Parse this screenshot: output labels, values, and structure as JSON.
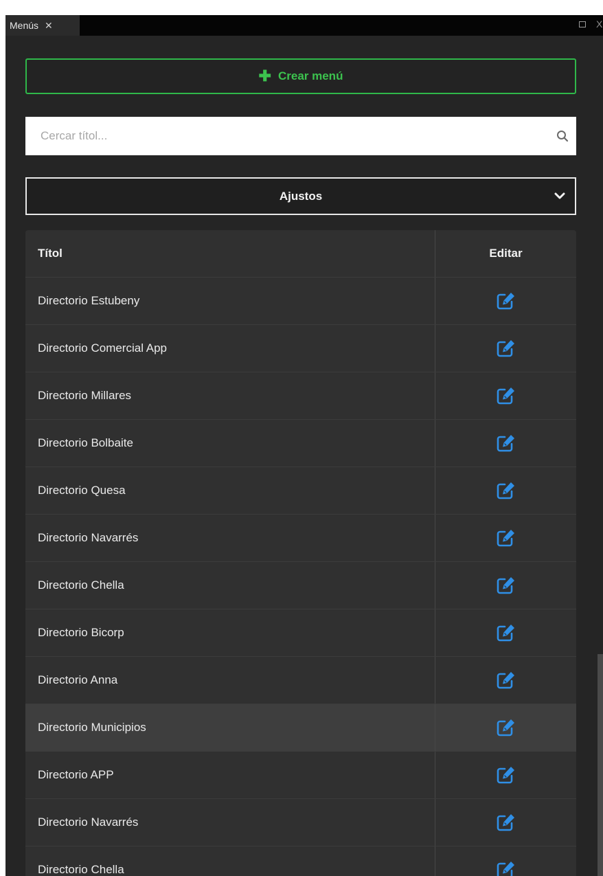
{
  "window": {
    "tab_label": "Menús",
    "tab_close_glyph": "✕",
    "next_tab_glyph": "X"
  },
  "toolbar": {
    "create_label": "Crear menú",
    "create_icon": "plus-icon"
  },
  "search": {
    "placeholder": "Cercar títol...",
    "value": "",
    "icon": "search-icon"
  },
  "settings_select": {
    "selected": "Ajustos",
    "icon": "chevron-down-icon"
  },
  "table": {
    "headers": {
      "title": "Títol",
      "edit": "Editar"
    },
    "rows": [
      {
        "title": "Directorio Estubeny"
      },
      {
        "title": "Directorio Comercial App"
      },
      {
        "title": "Directorio Millares"
      },
      {
        "title": "Directorio Bolbaite"
      },
      {
        "title": "Directorio Quesa"
      },
      {
        "title": "Directorio Navarrés"
      },
      {
        "title": "Directorio Chella"
      },
      {
        "title": "Directorio Bicorp"
      },
      {
        "title": "Directorio Anna"
      },
      {
        "title": "Directorio Municipios",
        "selected": true
      },
      {
        "title": "Directorio APP"
      },
      {
        "title": "Directorio Navarrés"
      },
      {
        "title": "Directorio Chella"
      }
    ],
    "edit_icon": "edit-icon"
  },
  "colors": {
    "accent_green": "#2fb84a",
    "edit_blue": "#2f8fe6",
    "panel_bg": "#252525",
    "row_bg": "#303030",
    "selected_row_bg": "#3e3e3e"
  }
}
